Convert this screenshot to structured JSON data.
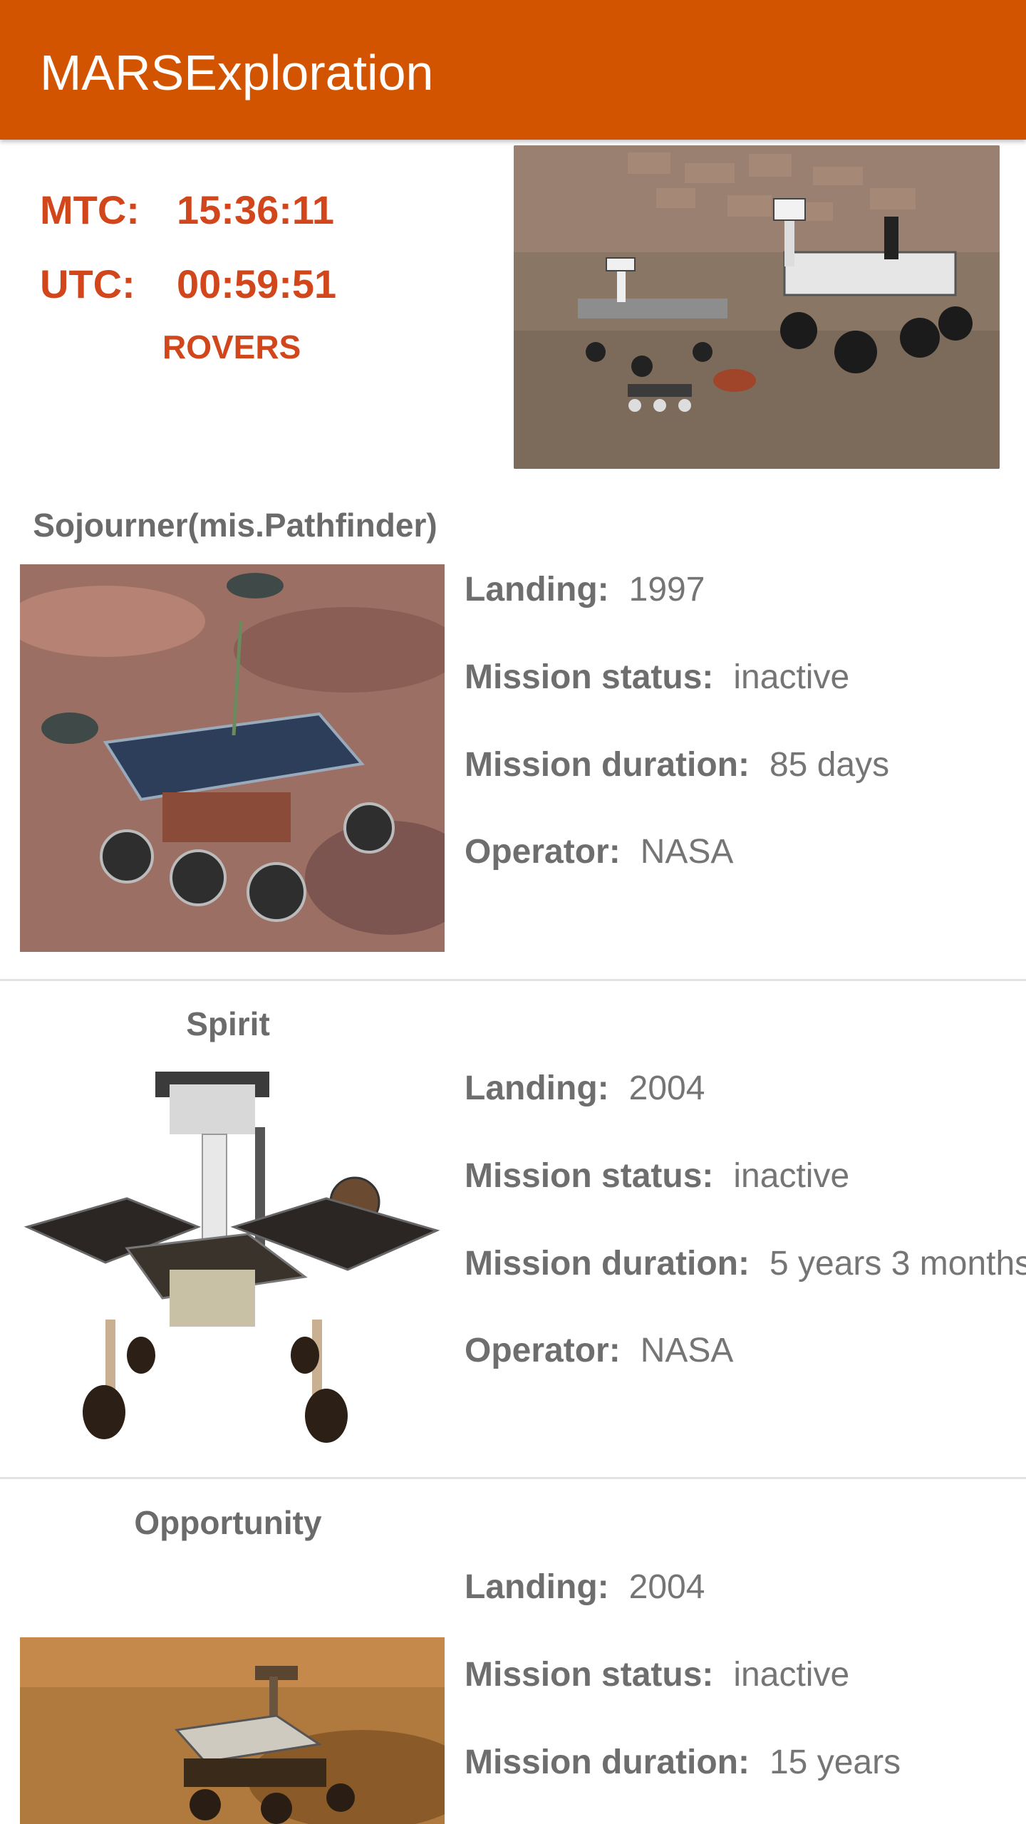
{
  "app": {
    "title": "MARSExploration",
    "accent": "#d35400"
  },
  "clock": {
    "mtc_label": "MTC:",
    "mtc_value": "15:36:11",
    "utc_label": "UTC:",
    "utc_value": "00:59:51",
    "section_label": "ROVERS"
  },
  "labels": {
    "landing": "Landing:",
    "status": "Mission status:",
    "duration": "Mission duration:",
    "operator": "Operator:"
  },
  "rovers": [
    {
      "name": "Sojourner(mis.Pathfinder)",
      "landing": "1997",
      "status": "inactive",
      "duration": "85 days",
      "operator": "NASA"
    },
    {
      "name": "Spirit",
      "landing": "2004",
      "status": "inactive",
      "duration": "5 years 3 months",
      "operator": "NASA"
    },
    {
      "name": "Opportunity",
      "landing": "2004",
      "status": "inactive",
      "duration": "15 years"
    }
  ]
}
